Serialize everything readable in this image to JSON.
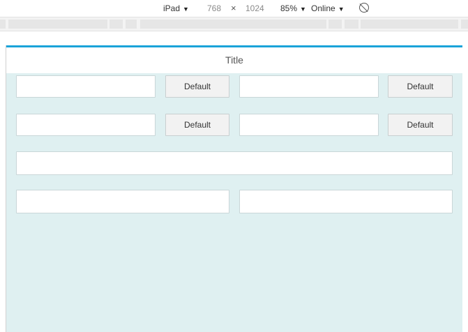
{
  "toolbar": {
    "device": "iPad",
    "width": "768",
    "separator": "×",
    "height": "1024",
    "zoom": "85%",
    "network": "Online"
  },
  "page": {
    "title": "Title",
    "buttons": [
      "Default",
      "Default",
      "Default",
      "Default"
    ]
  },
  "colors": {
    "accent": "#1aa3d9",
    "content_bg": "#dff0f1"
  }
}
